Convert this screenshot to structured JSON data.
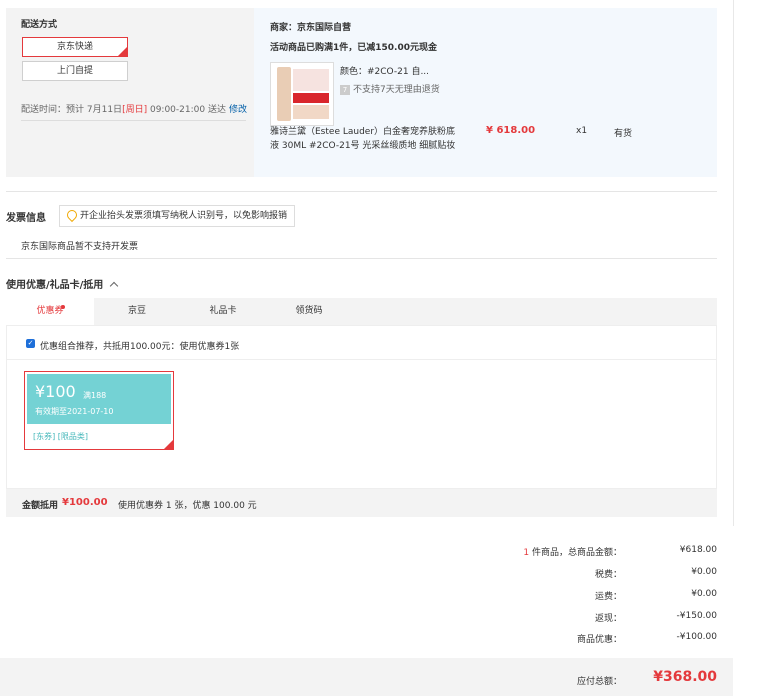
{
  "shipping": {
    "title": "配送方式",
    "options": [
      {
        "label": "京东快递",
        "selected": true
      },
      {
        "label": "上门自提",
        "selected": false
      }
    ],
    "time_label": "配送时间：",
    "time_prefix": "预计 7月11日",
    "time_day": "[周日]",
    "time_range": "09:00-21:00 送达",
    "edit_link": "修改"
  },
  "seller": {
    "name": "商家：京东国际自营",
    "promo": "活动商品已购满1件，已减150.00元现金",
    "product": {
      "color": "颜色：#2CO-21 自...",
      "return_policy": "不支持7天无理由退货",
      "title_line1": "雅诗兰黛（Estee Lauder）白金奢宠养肤粉底",
      "title_line2": "液 30ML #2CO-21号 光采丝缎质地 细腻贴妆",
      "price": "¥ 618.00",
      "qty": "x1",
      "stock": "有货"
    }
  },
  "invoice": {
    "title": "发票信息",
    "tip": "开企业抬头发票须填写纳税人识别号，以免影响报销",
    "note": "京东国际商品暂不支持开发票"
  },
  "discount": {
    "title": "使用优惠/礼品卡/抵用",
    "tabs": [
      "优惠券",
      "京豆",
      "礼品卡",
      "领货码"
    ],
    "recommend": "优惠组合推荐，共抵用100.00元：使用优惠券1张",
    "coupon": {
      "amount": "¥100",
      "condition": "满188",
      "validity": "有效期至2021-07-10",
      "tags": "[东券]  [限品类]"
    },
    "footer_label": "金额抵用",
    "footer_amount": "¥100.00",
    "footer_desc": "使用优惠券 1 张，优惠 100.00 元"
  },
  "summary": {
    "items_count": "1",
    "items_label": "件商品，总商品金额：",
    "items_total": "¥618.00",
    "rows": [
      {
        "label": "税费：",
        "value": "¥0.00"
      },
      {
        "label": "运费：",
        "value": "¥0.00"
      },
      {
        "label": "返现：",
        "value": "-¥150.00"
      },
      {
        "label": "商品优惠：",
        "value": "-¥100.00"
      }
    ],
    "payable_label": "应付总额：",
    "payable_value": "¥368.00"
  }
}
